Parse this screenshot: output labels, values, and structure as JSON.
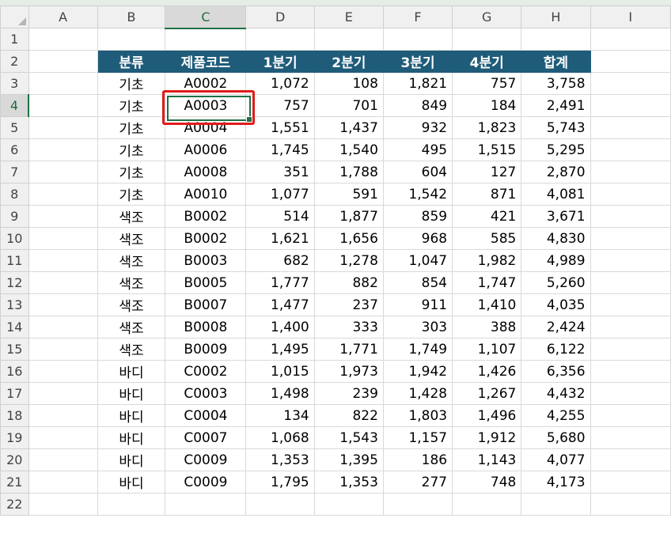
{
  "columns": [
    "",
    "A",
    "B",
    "C",
    "D",
    "E",
    "F",
    "G",
    "H",
    "I"
  ],
  "rows": [
    "1",
    "2",
    "3",
    "4",
    "5",
    "6",
    "7",
    "8",
    "9",
    "10",
    "11",
    "12",
    "13",
    "14",
    "15",
    "16",
    "17",
    "18",
    "19",
    "20",
    "21",
    "22"
  ],
  "table": {
    "headers": [
      "분류",
      "제품코드",
      "1분기",
      "2분기",
      "3분기",
      "4분기",
      "합계"
    ],
    "data": [
      [
        "기초",
        "A0002",
        "1,072",
        "108",
        "1,821",
        "757",
        "3,758"
      ],
      [
        "기초",
        "A0003",
        "757",
        "701",
        "849",
        "184",
        "2,491"
      ],
      [
        "기초",
        "A0004",
        "1,551",
        "1,437",
        "932",
        "1,823",
        "5,743"
      ],
      [
        "기초",
        "A0006",
        "1,745",
        "1,540",
        "495",
        "1,515",
        "5,295"
      ],
      [
        "기초",
        "A0008",
        "351",
        "1,788",
        "604",
        "127",
        "2,870"
      ],
      [
        "기초",
        "A0010",
        "1,077",
        "591",
        "1,542",
        "871",
        "4,081"
      ],
      [
        "색조",
        "B0002",
        "514",
        "1,877",
        "859",
        "421",
        "3,671"
      ],
      [
        "색조",
        "B0002",
        "1,621",
        "1,656",
        "968",
        "585",
        "4,830"
      ],
      [
        "색조",
        "B0003",
        "682",
        "1,278",
        "1,047",
        "1,982",
        "4,989"
      ],
      [
        "색조",
        "B0005",
        "1,777",
        "882",
        "854",
        "1,747",
        "5,260"
      ],
      [
        "색조",
        "B0007",
        "1,477",
        "237",
        "911",
        "1,410",
        "4,035"
      ],
      [
        "색조",
        "B0008",
        "1,400",
        "333",
        "303",
        "388",
        "2,424"
      ],
      [
        "색조",
        "B0009",
        "1,495",
        "1,771",
        "1,749",
        "1,107",
        "6,122"
      ],
      [
        "바디",
        "C0002",
        "1,015",
        "1,973",
        "1,942",
        "1,426",
        "6,356"
      ],
      [
        "바디",
        "C0003",
        "1,498",
        "239",
        "1,428",
        "1,267",
        "4,432"
      ],
      [
        "바디",
        "C0004",
        "134",
        "822",
        "1,803",
        "1,496",
        "4,255"
      ],
      [
        "바디",
        "C0007",
        "1,068",
        "1,543",
        "1,157",
        "1,912",
        "5,680"
      ],
      [
        "바디",
        "C0009",
        "1,353",
        "1,395",
        "186",
        "1,143",
        "4,077"
      ],
      [
        "바디",
        "C0009",
        "1,795",
        "1,353",
        "277",
        "748",
        "4,173"
      ]
    ]
  },
  "selection": {
    "cell": "C4",
    "column": "C",
    "row": "4"
  },
  "colors": {
    "header_bg": "#1f5c7a",
    "selection_border": "#1e7145",
    "highlight": "#e01b1b"
  }
}
